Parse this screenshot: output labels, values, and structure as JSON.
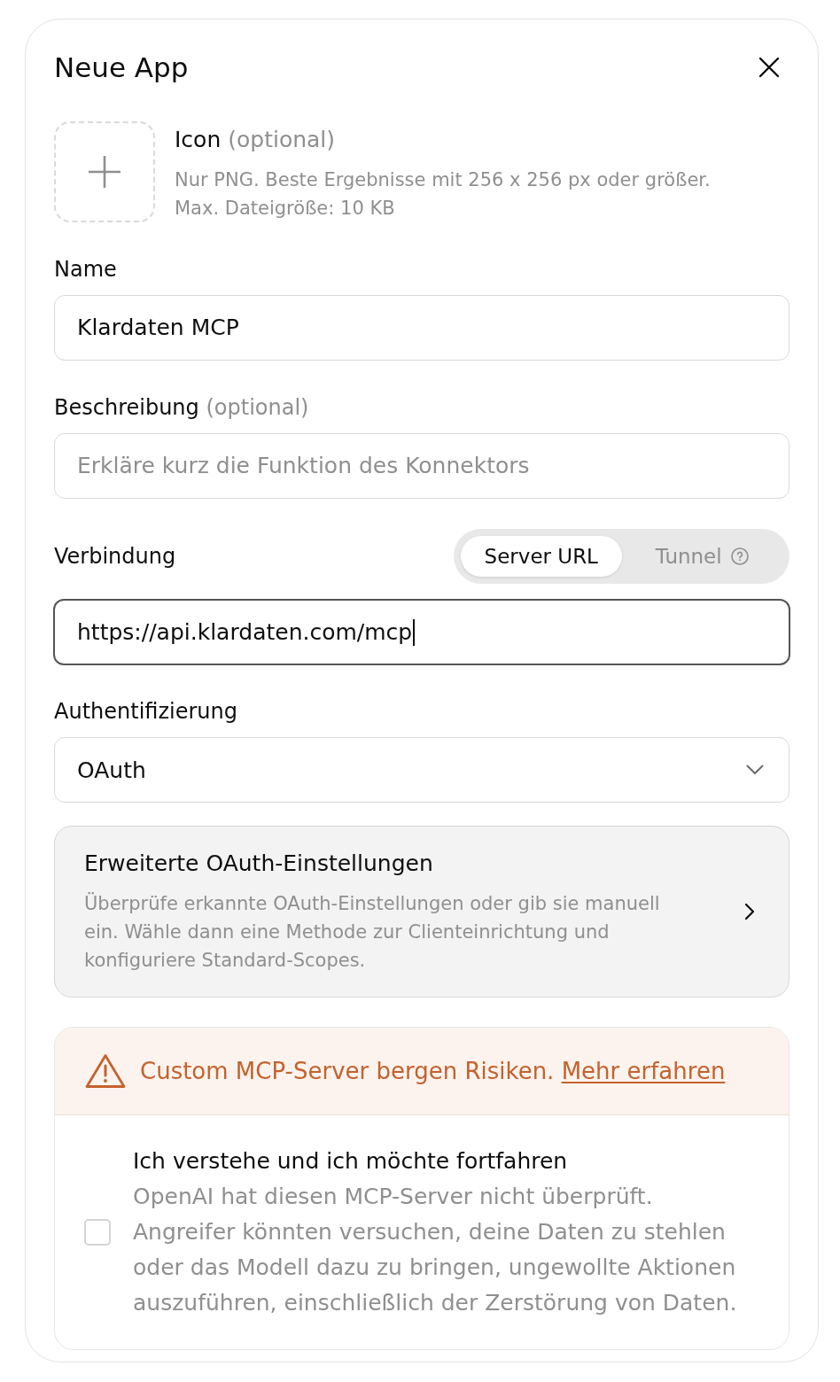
{
  "dialog": {
    "title": "Neue App"
  },
  "icon_upload": {
    "label": "Icon",
    "optional": "(optional)",
    "hint_lines": [
      "Nur PNG. Beste Ergebnisse mit 256 x 256 px oder größer.",
      "Max. Dateigröße: 10 KB"
    ]
  },
  "name": {
    "label": "Name",
    "value": "Klardaten MCP"
  },
  "description": {
    "label": "Beschreibung",
    "optional": "(optional)",
    "placeholder": "Erkläre kurz die Funktion des Konnektors"
  },
  "connection": {
    "label": "Verbindung",
    "tabs": [
      {
        "label": "Server URL",
        "selected": true,
        "help": false
      },
      {
        "label": "Tunnel",
        "selected": false,
        "help": true
      }
    ],
    "value": "https://api.klardaten.com/mcp",
    "focused": true
  },
  "authentication": {
    "label": "Authentifizierung",
    "value": "OAuth"
  },
  "advanced": {
    "title": "Erweiterte OAuth-Einstellungen",
    "description": "Überprüfe erkannte OAuth-Einstellungen oder gib sie manuell ein. Wähle dann eine Methode zur Clienteinrichtung und konfiguriere Standard-Scopes."
  },
  "warning": {
    "text": "Custom MCP-Server bergen Risiken.",
    "link": "Mehr erfahren",
    "consent": {
      "title": "Ich verstehe und ich möchte fortfahren",
      "description": "OpenAI hat diesen MCP-Server nicht überprüft. Angreifer könnten versuchen, deine Daten zu stehlen oder das Modell dazu zu bringen, ungewollte Aktionen auszuführen, einschließlich der Zerstörung von Daten.",
      "checked": false
    }
  }
}
